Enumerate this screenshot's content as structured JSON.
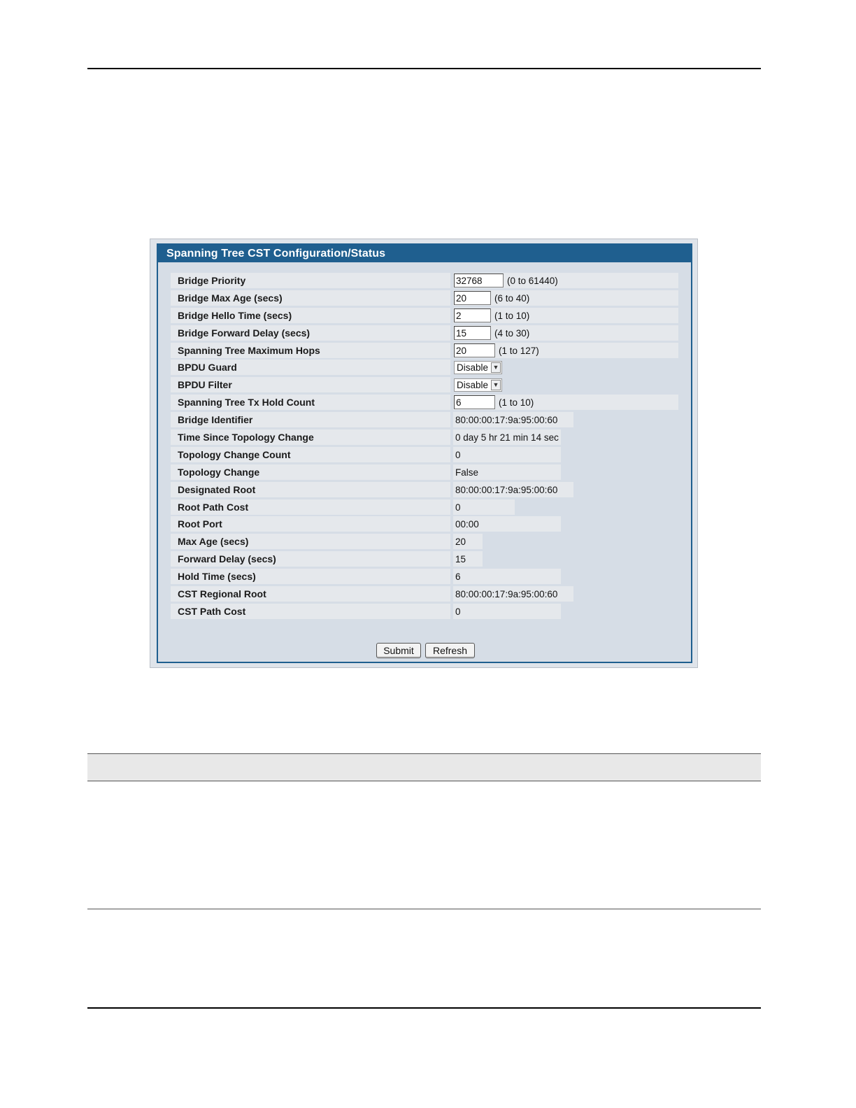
{
  "panel": {
    "title": "Spanning Tree CST Configuration/Status",
    "config_rows": [
      {
        "label": "Bridge Priority",
        "value": "32768",
        "range": "(0 to 61440)"
      },
      {
        "label": "Bridge Max Age (secs)",
        "value": "20",
        "range": "(6 to 40)"
      },
      {
        "label": "Bridge Hello Time (secs)",
        "value": "2",
        "range": "(1 to 10)"
      },
      {
        "label": "Bridge Forward Delay (secs)",
        "value": "15",
        "range": "(4 to 30)"
      },
      {
        "label": "Spanning Tree Maximum Hops",
        "value": "20",
        "range": "(1 to 127)"
      }
    ],
    "select_rows": [
      {
        "label": "BPDU Guard",
        "value": "Disable"
      },
      {
        "label": "BPDU Filter",
        "value": "Disable"
      }
    ],
    "hold_count": {
      "label": "Spanning Tree Tx Hold Count",
      "value": "6",
      "range": "(1 to 10)"
    },
    "status_rows": [
      {
        "label": "Bridge Identifier",
        "value": "80:00:00:17:9a:95:00:60"
      },
      {
        "label": "Time Since Topology Change",
        "value": "0 day 5 hr 21 min 14 sec"
      },
      {
        "label": "Topology Change Count",
        "value": "0"
      },
      {
        "label": "Topology Change",
        "value": "False"
      },
      {
        "label": "Designated Root",
        "value": "80:00:00:17:9a:95:00:60"
      },
      {
        "label": "Root Path Cost",
        "value": "0"
      },
      {
        "label": "Root Port",
        "value": "00:00"
      },
      {
        "label": "Max Age (secs)",
        "value": "20"
      },
      {
        "label": "Forward Delay (secs)",
        "value": "15"
      },
      {
        "label": "Hold Time (secs)",
        "value": "6"
      },
      {
        "label": "CST Regional Root",
        "value": "80:00:00:17:9a:95:00:60"
      },
      {
        "label": "CST Path Cost",
        "value": "0"
      }
    ],
    "buttons": {
      "submit": "Submit",
      "refresh": "Refresh"
    }
  }
}
